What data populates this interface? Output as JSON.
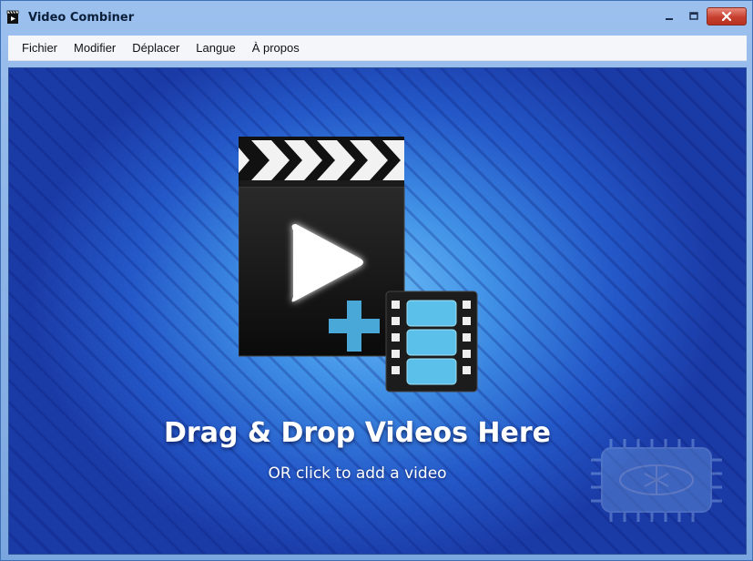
{
  "window": {
    "title": "Video Combiner"
  },
  "menu": {
    "items": [
      {
        "label": "Fichier"
      },
      {
        "label": "Modifier"
      },
      {
        "label": "Déplacer"
      },
      {
        "label": "Langue"
      },
      {
        "label": "À propos"
      }
    ]
  },
  "dropzone": {
    "headline": "Drag & Drop Videos Here",
    "subline": "OR click to add a video"
  },
  "colors": {
    "close_button": "#c7402f",
    "plus_accent": "#4aa8d8",
    "film_frame": "#5cc1ea"
  }
}
